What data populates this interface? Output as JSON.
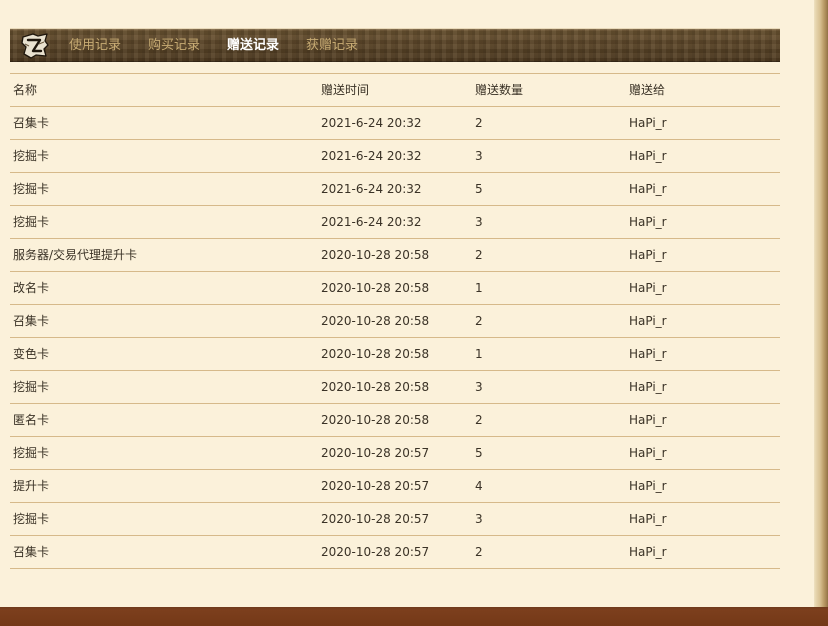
{
  "tabs": [
    {
      "label": "使用记录",
      "active": false
    },
    {
      "label": "购买记录",
      "active": false
    },
    {
      "label": "赠送记录",
      "active": true
    },
    {
      "label": "获赠记录",
      "active": false
    }
  ],
  "logo": {
    "icon": "game-logo-icon"
  },
  "table": {
    "headers": [
      "名称",
      "赠送时间",
      "赠送数量",
      "赠送给"
    ],
    "rows": [
      [
        "召集卡",
        "2021-6-24 20:32",
        "2",
        "HaPi_r"
      ],
      [
        "挖掘卡",
        "2021-6-24 20:32",
        "3",
        "HaPi_r"
      ],
      [
        "挖掘卡",
        "2021-6-24 20:32",
        "5",
        "HaPi_r"
      ],
      [
        "挖掘卡",
        "2021-6-24 20:32",
        "3",
        "HaPi_r"
      ],
      [
        "服务器/交易代理提升卡",
        "2020-10-28 20:58",
        "2",
        "HaPi_r"
      ],
      [
        "改名卡",
        "2020-10-28 20:58",
        "1",
        "HaPi_r"
      ],
      [
        "召集卡",
        "2020-10-28 20:58",
        "2",
        "HaPi_r"
      ],
      [
        "变色卡",
        "2020-10-28 20:58",
        "1",
        "HaPi_r"
      ],
      [
        "挖掘卡",
        "2020-10-28 20:58",
        "3",
        "HaPi_r"
      ],
      [
        "匿名卡",
        "2020-10-28 20:58",
        "2",
        "HaPi_r"
      ],
      [
        "挖掘卡",
        "2020-10-28 20:57",
        "5",
        "HaPi_r"
      ],
      [
        "提升卡",
        "2020-10-28 20:57",
        "4",
        "HaPi_r"
      ],
      [
        "挖掘卡",
        "2020-10-28 20:57",
        "3",
        "HaPi_r"
      ],
      [
        "召集卡",
        "2020-10-28 20:57",
        "2",
        "HaPi_r"
      ]
    ]
  },
  "colors": {
    "page_background": "#fbf1da",
    "tab_bar": "#5b4528",
    "tab_inactive": "#c7ab73",
    "tab_active": "#ffffff",
    "row_divider": "#d6b98a",
    "text": "#3a3226",
    "bottom_bar": "#743817"
  }
}
